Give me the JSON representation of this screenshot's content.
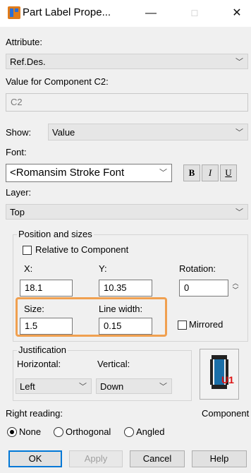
{
  "window": {
    "title": "Part Label Prope...",
    "minimize": "—",
    "maximize": "☐",
    "close": "✕"
  },
  "attribute": {
    "label": "Attribute:",
    "value": "Ref.Des."
  },
  "component_value": {
    "label": "Value for Component C2:",
    "value": "C2"
  },
  "show": {
    "label": "Show:",
    "value": "Value"
  },
  "font": {
    "label": "Font:",
    "value": "<Romansim Stroke Font",
    "bold": "B",
    "italic": "I",
    "underline": "U"
  },
  "layer": {
    "label": "Layer:",
    "value": "Top"
  },
  "position": {
    "legend": "Position and sizes",
    "relative_label": "Relative to Component",
    "relative_checked": false,
    "x_label": "X:",
    "x_value": "18.1",
    "y_label": "Y:",
    "y_value": "10.35",
    "rotation_label": "Rotation:",
    "rotation_value": "0",
    "size_label": "Size:",
    "size_value": "1.5",
    "linewidth_label": "Line width:",
    "linewidth_value": "0.15",
    "mirrored_label": "Mirrored",
    "mirrored_checked": false
  },
  "justification": {
    "legend": "Justification",
    "horizontal_label": "Horizontal:",
    "horizontal_value": "Left",
    "vertical_label": "Vertical:",
    "vertical_value": "Down"
  },
  "component_button_label": "Component",
  "right_reading": {
    "label": "Right reading:",
    "options": [
      "None",
      "Orthogonal",
      "Angled"
    ],
    "selected": "None"
  },
  "buttons": {
    "ok": "OK",
    "apply": "Apply",
    "cancel": "Cancel",
    "help": "Help"
  },
  "colors": {
    "highlight": "#f0a050",
    "default_button_border": "#0078d7",
    "icon_blue": "#2a6fd6",
    "icon_orange": "#e07b1a",
    "component_icon_red": "#d11"
  }
}
